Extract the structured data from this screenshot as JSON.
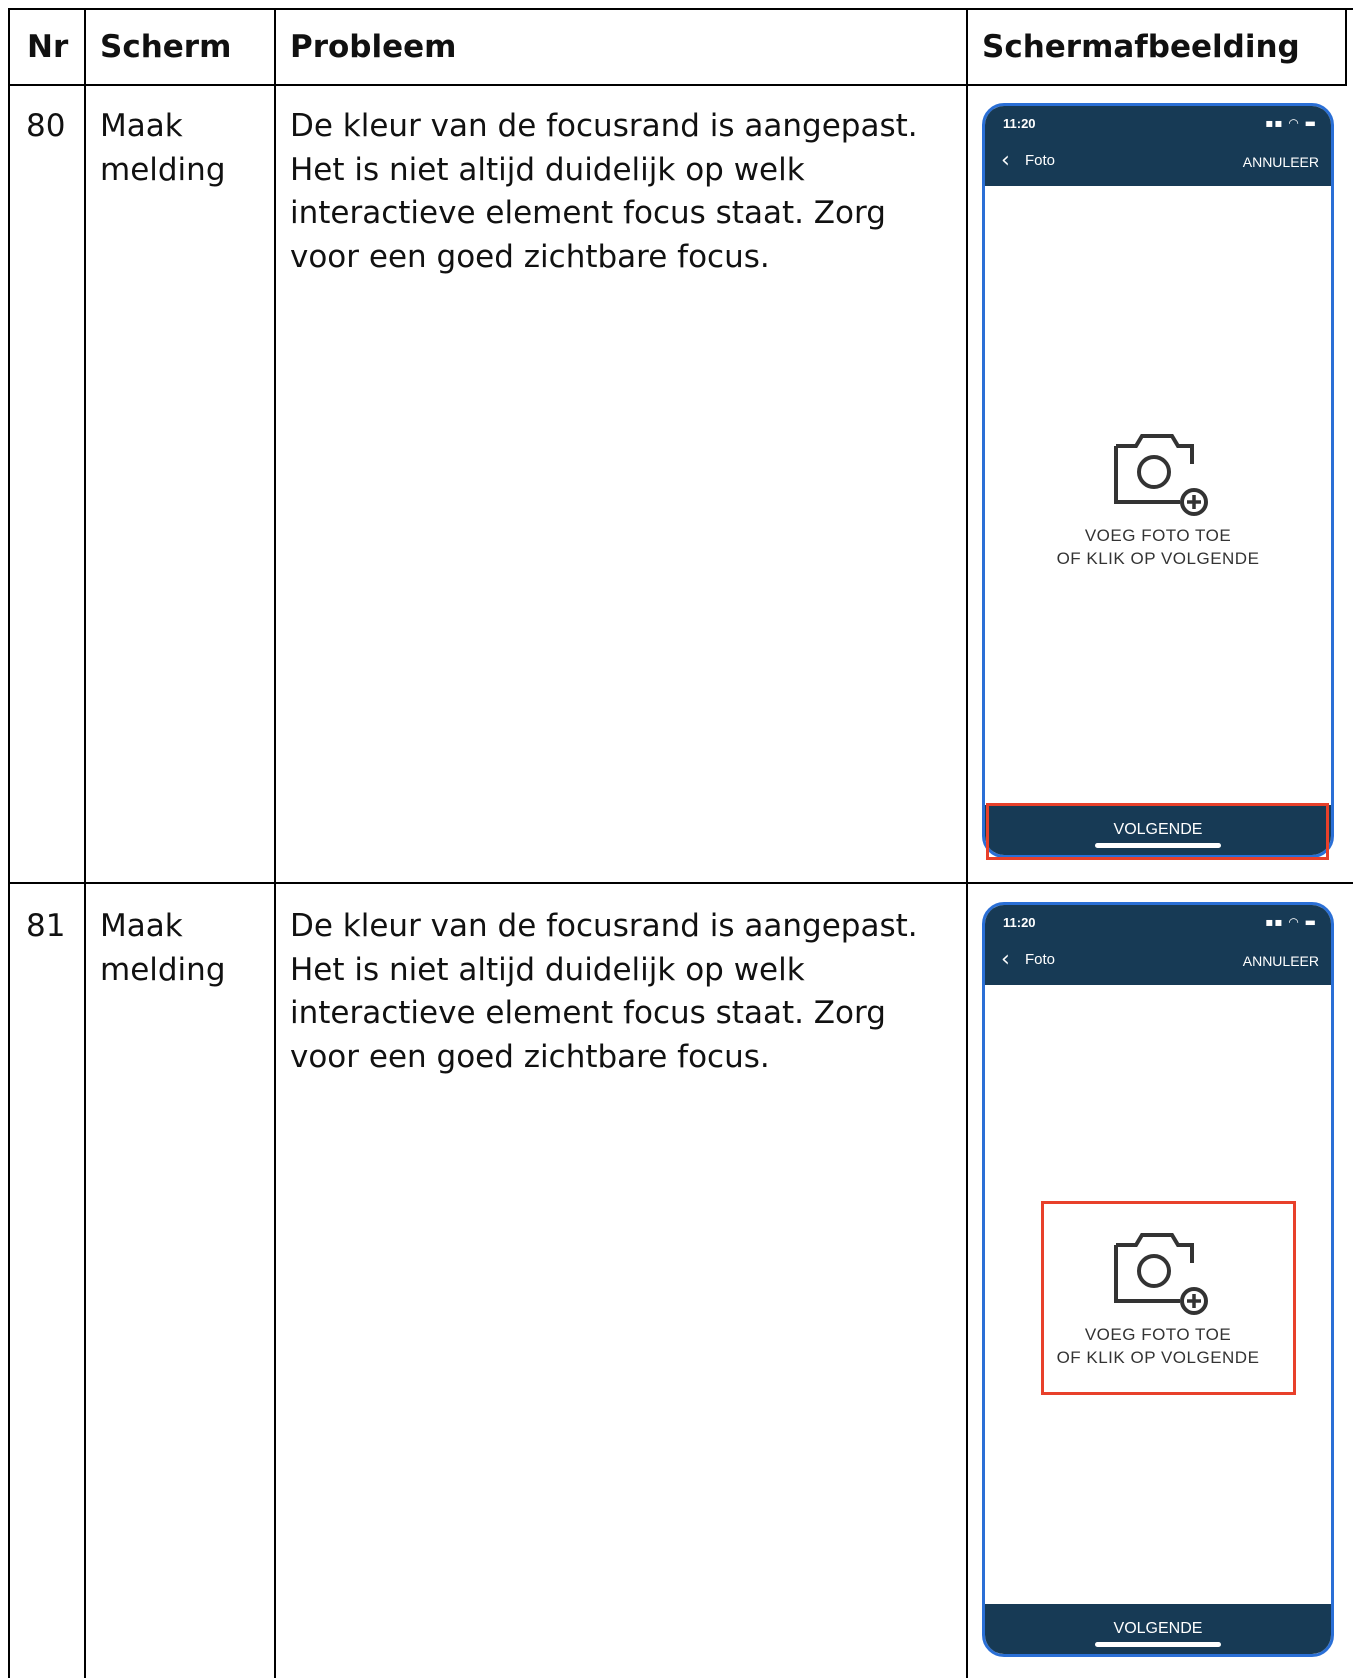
{
  "table": {
    "headers": [
      "Nr",
      "Scherm",
      "Probleem",
      "Schermafbeelding"
    ],
    "rows": [
      {
        "nr": "80",
        "scherm": "Maak\nmelding",
        "probleem": "De kleur van de focusrand is aangepast. Het is niet altijd duidelijk op welk interactieve element focus staat. Zorg voor een goed zichtbare focus.",
        "highlight": "volgende-button"
      },
      {
        "nr": "81",
        "scherm": "Maak\nmelding",
        "probleem": "De kleur van de focusrand is aangepast. Het is niet altijd duidelijk op welk interactieve element focus staat. Zorg voor een goed zichtbare focus.",
        "highlight": "add-photo-area"
      }
    ]
  },
  "phone": {
    "time": "11:20",
    "nav_title": "Foto",
    "cancel_label": "ANNULEER",
    "hint_line1": "VOEG FOTO TOE",
    "hint_line2": "OF KLIK OP VOLGENDE",
    "next_label": "VOLGENDE",
    "back_icon": "chevron-left-icon",
    "camera_icon": "camera-add-icon"
  },
  "colors": {
    "nav_bg": "#173a55",
    "focus_outline": "#e8402a",
    "device_border": "#2a6fd6"
  }
}
